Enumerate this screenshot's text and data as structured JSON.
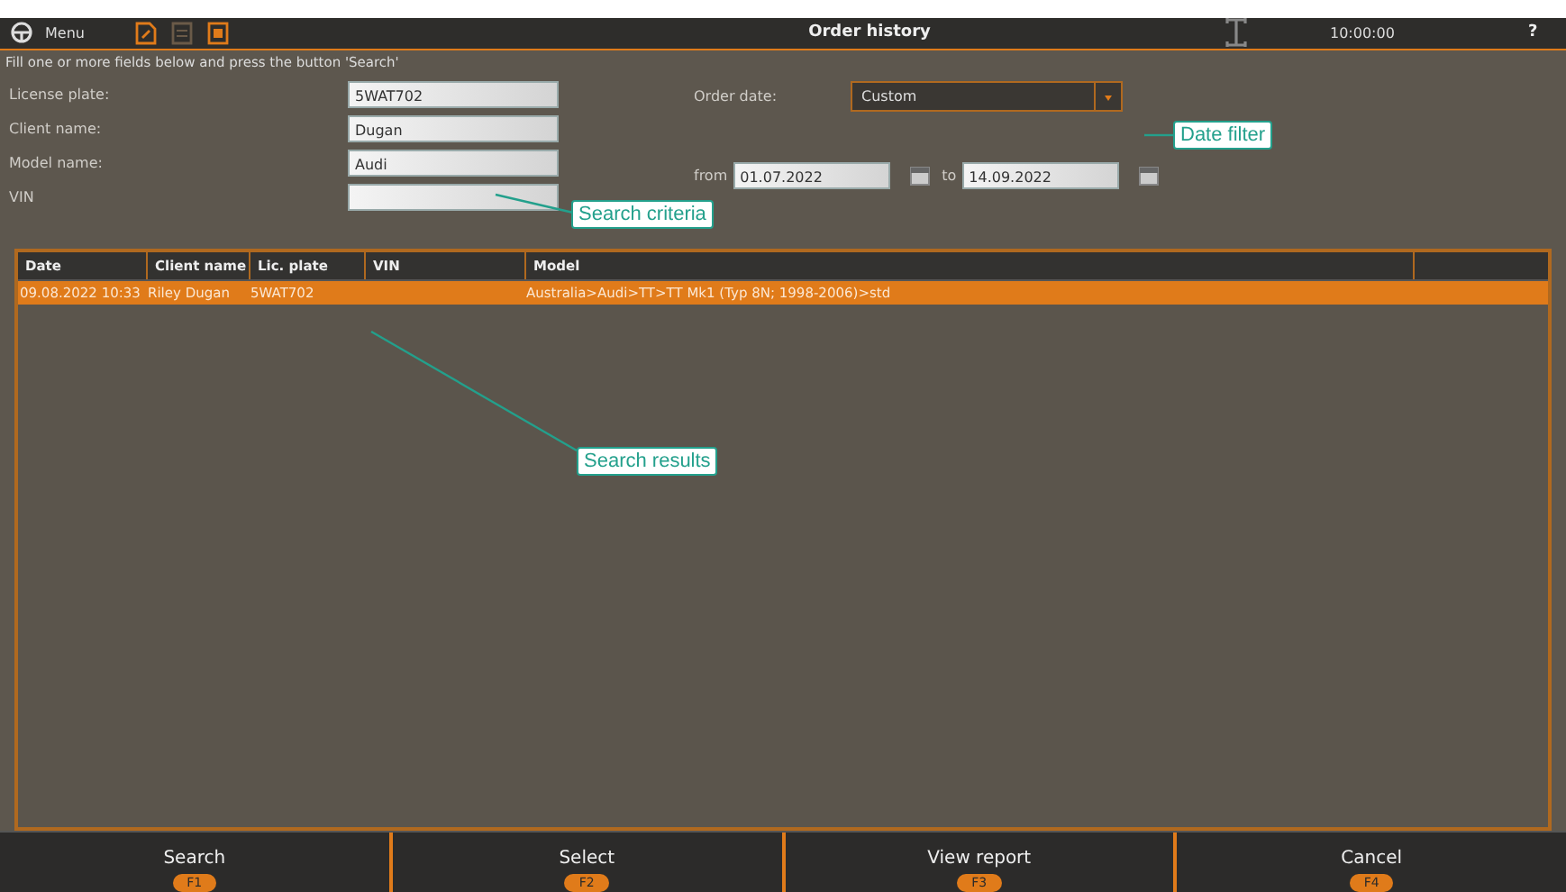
{
  "toolbar": {
    "menu_label": "Menu",
    "title": "Order history",
    "clock": "10:00:00",
    "help": "?"
  },
  "instruction": "Fill one or more fields below and press the button 'Search'",
  "fields": [
    {
      "label": "License plate:",
      "value": "5WAT702"
    },
    {
      "label": "Client name:",
      "value": "Dugan"
    },
    {
      "label": "Model name:",
      "value": "Audi"
    },
    {
      "label": "VIN"
    }
  ],
  "order_date": {
    "label": "Order date:",
    "value": "Custom",
    "from_label": "from",
    "from": "01.07.2022",
    "to_label": "to",
    "to": "14.09.2022"
  },
  "table": {
    "columns": [
      "Date",
      "Client name",
      "Lic. plate",
      "VIN",
      "Model"
    ],
    "rows": [
      {
        "cells": [
          "09.08.2022 10:33",
          "Riley Dugan",
          "5WAT702",
          "",
          "Australia>Audi>TT>TT Mk1 (Typ 8N; 1998-2006)>std"
        ],
        "selected": true
      }
    ]
  },
  "callouts": [
    "Search criteria",
    "Date filter",
    "Search results"
  ],
  "buttons": [
    {
      "label": "Search",
      "key": "F1"
    },
    {
      "label": "Select",
      "key": "F2"
    },
    {
      "label": "View report",
      "key": "F3"
    },
    {
      "label": "Cancel",
      "key": "F4"
    }
  ]
}
